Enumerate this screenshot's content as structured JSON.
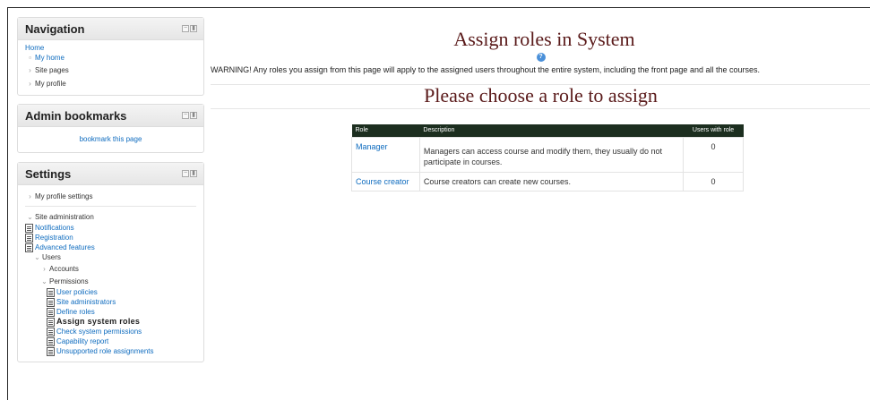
{
  "navigation": {
    "title": "Navigation",
    "home": "Home",
    "items": [
      "My home",
      "Site pages",
      "My profile"
    ]
  },
  "admin_bookmarks": {
    "title": "Admin bookmarks",
    "link": "bookmark this page"
  },
  "settings": {
    "title": "Settings",
    "my_profile_settings": "My profile settings",
    "site_admin": "Site administration",
    "admin_items": [
      "Notifications",
      "Registration",
      "Advanced features"
    ],
    "users": "Users",
    "accounts": "Accounts",
    "permissions": "Permissions",
    "permission_items": [
      "User policies",
      "Site administrators",
      "Define roles",
      "Assign system roles",
      "Check system permissions",
      "Capability report",
      "Unsupported role assignments"
    ]
  },
  "main": {
    "title": "Assign roles in System",
    "warning": "WARNING! Any roles you assign from this page will apply to the assigned users throughout the entire system, including the front page and all the courses.",
    "sub_heading": "Please choose a role to assign",
    "table": {
      "headers": [
        "Role",
        "Description",
        "Users with role"
      ],
      "rows": [
        {
          "role": "Manager",
          "description": "Managers can access course and modify them, they usually do not participate in courses.",
          "count": "0"
        },
        {
          "role": "Course creator",
          "description": "Course creators can create new courses.",
          "count": "0"
        }
      ]
    }
  }
}
